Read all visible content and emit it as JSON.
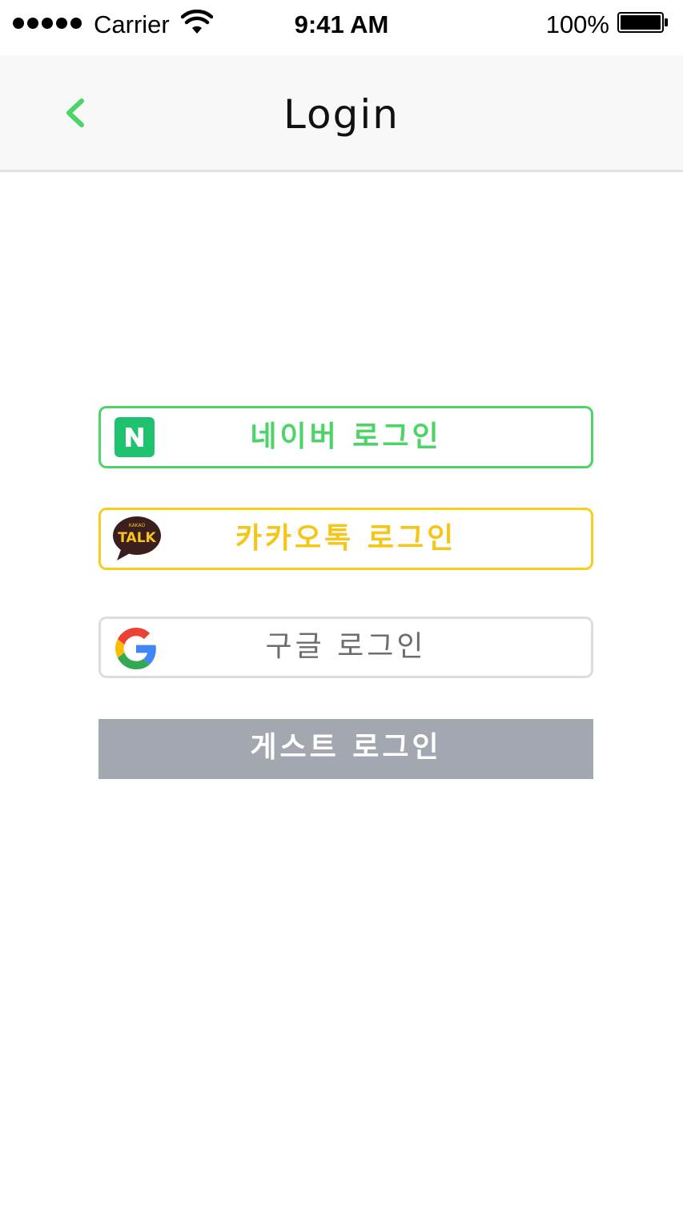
{
  "status_bar": {
    "carrier": "Carrier",
    "time": "9:41 AM",
    "battery": "100%",
    "icons": [
      "signal-dots-icon",
      "wifi-icon",
      "battery-icon"
    ]
  },
  "nav": {
    "title": "Login",
    "back_icon": "chevron-left-icon",
    "accent_color": "#4cd467"
  },
  "logins": {
    "naver": {
      "label": "네이버 로그인",
      "icon": "naver-logo-icon",
      "logo_text": "N",
      "color": "#4cd467"
    },
    "kakao": {
      "label": "카카오톡 로그인",
      "icon": "kakaotalk-logo-icon",
      "logo_text": "TALK",
      "logo_small": "KAKAO",
      "color": "#f5c518"
    },
    "google": {
      "label": "구글 로그인",
      "icon": "google-logo-icon",
      "color": "#6d6d6d"
    },
    "guest": {
      "label": "게스트 로그인",
      "color": "#a3a8b0"
    }
  }
}
